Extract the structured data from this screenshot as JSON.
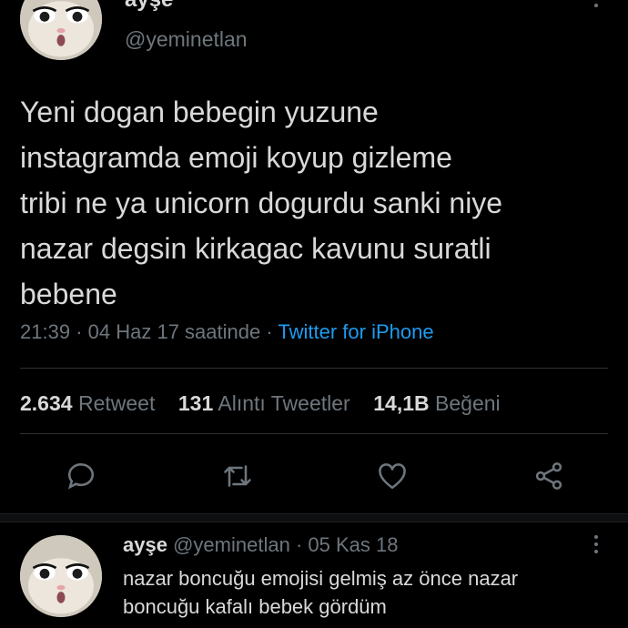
{
  "tweet": {
    "author_name": "ayşe",
    "handle": "@yeminetlan",
    "text_lines": [
      "Yeni dogan bebegin yuzune",
      "instagramda emoji koyup gizleme",
      "tribi ne ya unicorn dogurdu sanki niye",
      "nazar degsin kirkagac kavunu suratli",
      "bebene"
    ],
    "time": "21:39",
    "date": "04 Haz 17 saatinde",
    "separator": "·",
    "source": "Twitter for iPhone"
  },
  "stats": {
    "retweets_count": "2.634",
    "retweets_label": "Retweet",
    "quotes_count": "131",
    "quotes_label": "Alıntı Tweetler",
    "likes_count": "14,1B",
    "likes_label": "Beğeni"
  },
  "actions": {
    "reply_icon": "speech-bubble-icon",
    "retweet_icon": "retweet-icon",
    "like_icon": "heart-icon",
    "share_icon": "share-icon"
  },
  "reply": {
    "author_name": "ayşe",
    "handle": "@yeminetlan",
    "separator": "·",
    "date": "05 Kas 18",
    "text_lines": [
      "nazar boncuğu emojisi gelmiş az önce nazar",
      "boncuğu kafalı bebek gördüm"
    ]
  },
  "colors": {
    "background": "#000000",
    "text": "#d9d9d9",
    "muted": "#6e767d",
    "accent": "#1d9bf0",
    "divider": "#2f3336"
  }
}
